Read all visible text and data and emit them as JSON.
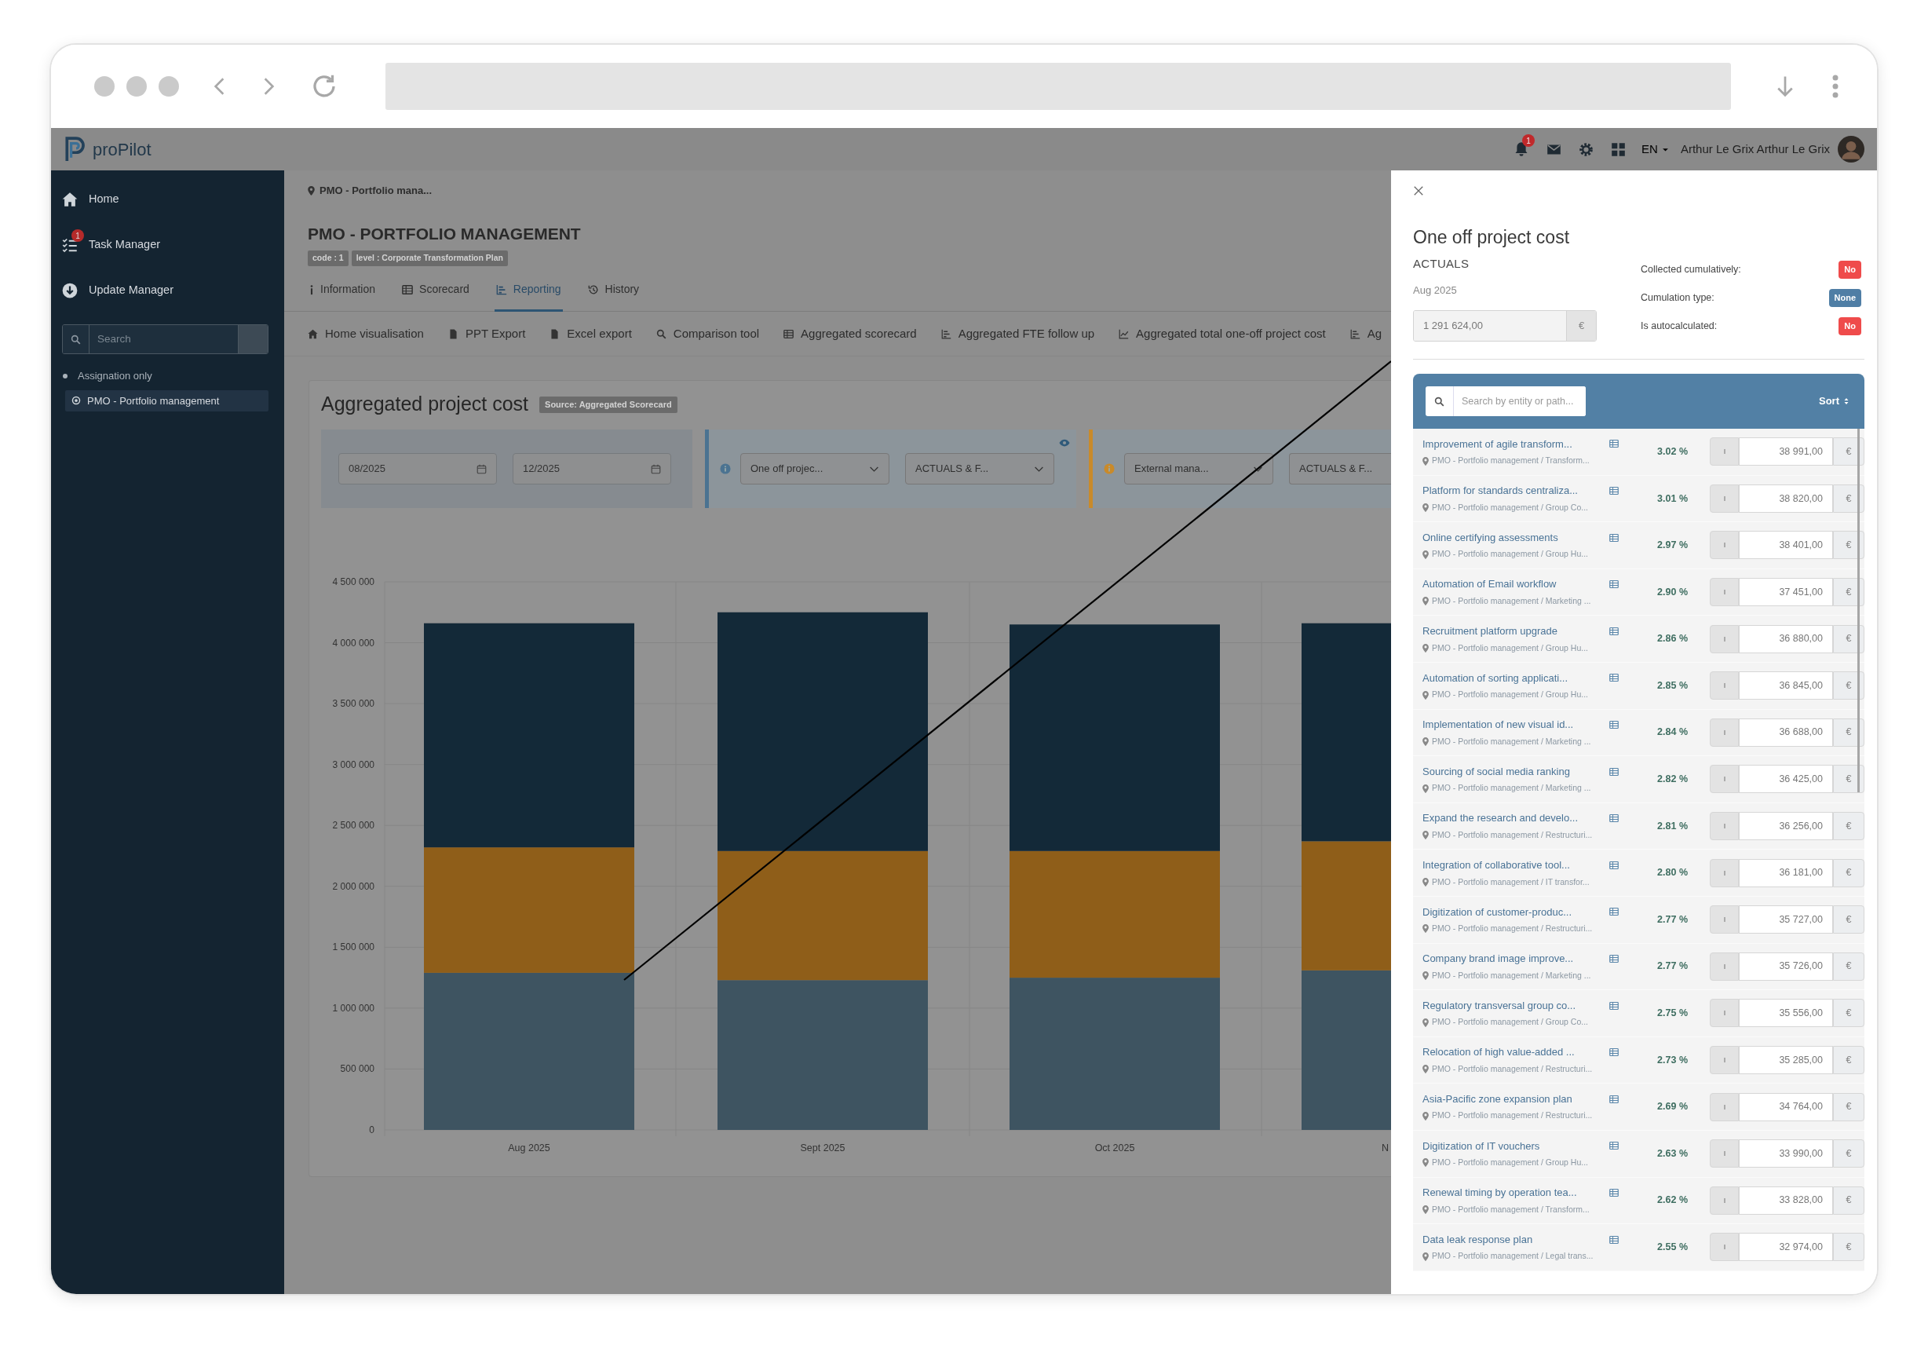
{
  "header": {
    "logo": "proPilot",
    "notifications": "1",
    "language": "EN",
    "user_name": "Arthur Le Grix Arthur Le Grix"
  },
  "sidebar": {
    "items": [
      {
        "label": "Home"
      },
      {
        "label": "Task Manager",
        "badge": "1"
      },
      {
        "label": "Update Manager"
      }
    ],
    "search_placeholder": "Search",
    "filter": "Assignation only",
    "tree": [
      {
        "label": "PMO - Portfolio management",
        "selected": true
      }
    ]
  },
  "breadcrumb": "PMO - Portfolio mana...",
  "title": "PMO - PORTFOLIO MANAGEMENT",
  "tags": [
    "code : 1",
    "level : Corporate Transformation Plan"
  ],
  "tabs": [
    {
      "label": "Information",
      "selected": false
    },
    {
      "label": "Scorecard",
      "selected": false
    },
    {
      "label": "Reporting",
      "selected": true
    },
    {
      "label": "History",
      "selected": false
    }
  ],
  "toolbar": [
    "Home visualisation",
    "PPT Export",
    "Excel export",
    "Comparison tool",
    "Aggregated scorecard",
    "Aggregated FTE follow up",
    "Aggregated total one-off project cost",
    "Ag"
  ],
  "report": {
    "title": "Aggregated project cost",
    "source": "Source: Aggregated Scorecard",
    "period": {
      "from": "08/2025",
      "to": "12/2025"
    },
    "filters": [
      {
        "color": "#4b7391",
        "indicator": "One off projec...",
        "scenario": "ACTUALS & F..."
      },
      {
        "color": "#c98a2a",
        "indicator": "External mana...",
        "scenario": "ACTUALS & F..."
      }
    ],
    "chart_data": {
      "type": "bar",
      "stacked": true,
      "grid": true,
      "categories": [
        "Aug 2025",
        "Sept 2025",
        "Oct 2025",
        "N"
      ],
      "ylim": [
        0,
        4500000
      ],
      "yticks": [
        {
          "value": 0,
          "label": "0"
        },
        {
          "value": 500000,
          "label": "500 000"
        },
        {
          "value": 1000000,
          "label": "1 000 000"
        },
        {
          "value": 1500000,
          "label": "1 500 000"
        },
        {
          "value": 2000000,
          "label": "2 000 000"
        },
        {
          "value": 2500000,
          "label": "2 500 000"
        },
        {
          "value": 3000000,
          "label": "3 000 000"
        },
        {
          "value": 3500000,
          "label": "3 500 000"
        },
        {
          "value": 4000000,
          "label": "4 000 000"
        },
        {
          "value": 4500000,
          "label": "4 500 000"
        }
      ],
      "series": [
        {
          "color": "#3e5461",
          "values": [
            1290000,
            1230000,
            1250000,
            1310000
          ]
        },
        {
          "color": "#8f5e19",
          "values": [
            1030000,
            1060000,
            1040000,
            1060000
          ]
        },
        {
          "color": "#132938",
          "values": [
            1840000,
            1960000,
            1860000,
            1790000
          ]
        }
      ]
    }
  },
  "panel": {
    "title": "One off project cost",
    "scenario": "ACTUALS",
    "period": "Aug 2025",
    "total": "1 291 624,00",
    "currency": "€",
    "properties": [
      {
        "label": "Collected cumulatively:",
        "value": "No",
        "color": "#ef4b4b"
      },
      {
        "label": "Cumulation type:",
        "value": "None",
        "color": "#4f7ea5"
      },
      {
        "label": "Is autocalculated:",
        "value": "No",
        "color": "#ef4b4b"
      }
    ],
    "search_placeholder": "Search by entity or path...",
    "sort": "Sort",
    "rows": [
      {
        "name": "Improvement of agile transform...",
        "path": "PMO - Portfolio management / Transform...",
        "share": "3.02 %",
        "value": "38 991,00",
        "currency": "€"
      },
      {
        "name": "Platform for standards centraliza...",
        "path": "PMO - Portfolio management / Group Co...",
        "share": "3.01 %",
        "value": "38 820,00",
        "currency": "€"
      },
      {
        "name": "Online certifying assessments",
        "path": "PMO - Portfolio management / Group Hu...",
        "share": "2.97 %",
        "value": "38 401,00",
        "currency": "€"
      },
      {
        "name": "Automation of Email workflow",
        "path": "PMO - Portfolio management / Marketing ...",
        "share": "2.90 %",
        "value": "37 451,00",
        "currency": "€"
      },
      {
        "name": "Recruitment platform upgrade",
        "path": "PMO - Portfolio management / Group Hu...",
        "share": "2.86 %",
        "value": "36 880,00",
        "currency": "€"
      },
      {
        "name": "Automation of sorting applicati...",
        "path": "PMO - Portfolio management / Group Hu...",
        "share": "2.85 %",
        "value": "36 845,00",
        "currency": "€"
      },
      {
        "name": "Implementation of new visual id...",
        "path": "PMO - Portfolio management / Marketing ...",
        "share": "2.84 %",
        "value": "36 688,00",
        "currency": "€"
      },
      {
        "name": "Sourcing of social media ranking",
        "path": "PMO - Portfolio management / Marketing ...",
        "share": "2.82 %",
        "value": "36 425,00",
        "currency": "€"
      },
      {
        "name": "Expand the research and develo...",
        "path": "PMO - Portfolio management / Restructuri...",
        "share": "2.81 %",
        "value": "36 256,00",
        "currency": "€"
      },
      {
        "name": "Integration of collaborative tool...",
        "path": "PMO - Portfolio management / IT transfor...",
        "share": "2.80 %",
        "value": "36 181,00",
        "currency": "€"
      },
      {
        "name": "Digitization of customer-produc...",
        "path": "PMO - Portfolio management / Restructuri...",
        "share": "2.77 %",
        "value": "35 727,00",
        "currency": "€"
      },
      {
        "name": "Company brand image improve...",
        "path": "PMO - Portfolio management / Marketing ...",
        "share": "2.77 %",
        "value": "35 726,00",
        "currency": "€"
      },
      {
        "name": "Regulatory transversal group co...",
        "path": "PMO - Portfolio management / Group Co...",
        "share": "2.75 %",
        "value": "35 556,00",
        "currency": "€"
      },
      {
        "name": "Relocation of high value-added ...",
        "path": "PMO - Portfolio management / Restructuri...",
        "share": "2.73 %",
        "value": "35 285,00",
        "currency": "€"
      },
      {
        "name": "Asia-Pacific zone expansion plan",
        "path": "PMO - Portfolio management / Restructuri...",
        "share": "2.69 %",
        "value": "34 764,00",
        "currency": "€"
      },
      {
        "name": "Digitization of IT vouchers",
        "path": "PMO - Portfolio management / Group Hu...",
        "share": "2.63 %",
        "value": "33 990,00",
        "currency": "€"
      },
      {
        "name": "Renewal timing by operation tea...",
        "path": "PMO - Portfolio management / Transform...",
        "share": "2.62 %",
        "value": "33 828,00",
        "currency": "€"
      },
      {
        "name": "Data leak response plan",
        "path": "PMO - Portfolio management / Legal trans...",
        "share": "2.55 %",
        "value": "32 974,00",
        "currency": "€"
      }
    ]
  }
}
